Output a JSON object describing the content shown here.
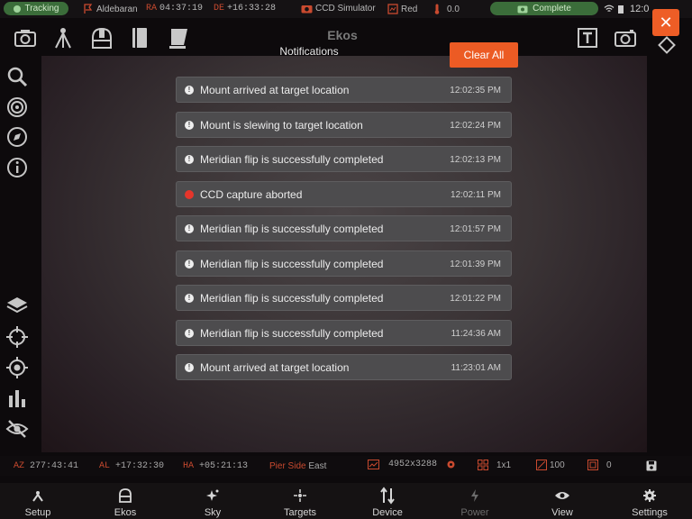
{
  "status": {
    "tracking": "Tracking",
    "target": "Aldebaran",
    "ra_label": "RA",
    "ra": "04:37:19",
    "de_label": "DE",
    "de": "+16:33:28",
    "camera": "CCD Simulator",
    "filter": "Red",
    "temperature": "0.0",
    "capture": "Complete",
    "clock": "12:0"
  },
  "header": {
    "title": "Ekos"
  },
  "notifications": {
    "title": "Notifications",
    "clear_label": "Clear All",
    "close_glyph": "✕",
    "items": [
      {
        "message": "Mount arrived at target location",
        "time": "12:02:35 PM",
        "level": "info"
      },
      {
        "message": "Mount is slewing to target location",
        "time": "12:02:24 PM",
        "level": "info"
      },
      {
        "message": "Meridian flip is successfully completed",
        "time": "12:02:13 PM",
        "level": "info"
      },
      {
        "message": "CCD capture aborted",
        "time": "12:02:11 PM",
        "level": "error"
      },
      {
        "message": "Meridian flip is successfully completed",
        "time": "12:01:57 PM",
        "level": "info"
      },
      {
        "message": "Meridian flip is successfully completed",
        "time": "12:01:39 PM",
        "level": "info"
      },
      {
        "message": "Meridian flip is successfully completed",
        "time": "12:01:22 PM",
        "level": "info"
      },
      {
        "message": "Meridian flip is successfully completed",
        "time": "11:24:36 AM",
        "level": "info"
      },
      {
        "message": "Mount arrived at target location",
        "time": "11:23:01 AM",
        "level": "info"
      }
    ]
  },
  "info": {
    "az_label": "AZ",
    "az": "277:43:41",
    "al_label": "AL",
    "al": "+17:32:30",
    "ha_label": "HA",
    "ha": "+05:21:13",
    "pier_label": "Pier Side",
    "pier": "East",
    "resolution": "4952x3288",
    "binning": "1x1",
    "gain": "100",
    "offset": "0"
  },
  "nav": [
    {
      "label": "Setup",
      "icon": "setup-icon"
    },
    {
      "label": "Ekos",
      "icon": "ekos-icon"
    },
    {
      "label": "Sky",
      "icon": "sky-icon"
    },
    {
      "label": "Targets",
      "icon": "targets-icon"
    },
    {
      "label": "Device",
      "icon": "device-icon"
    },
    {
      "label": "Power",
      "icon": "power-icon"
    },
    {
      "label": "View",
      "icon": "view-icon"
    },
    {
      "label": "Settings",
      "icon": "settings-icon"
    }
  ],
  "colors": {
    "accent": "#ec5b24",
    "pill_green": "#3b6d3a",
    "card": "#4d4c4e",
    "error": "#e5352b"
  }
}
